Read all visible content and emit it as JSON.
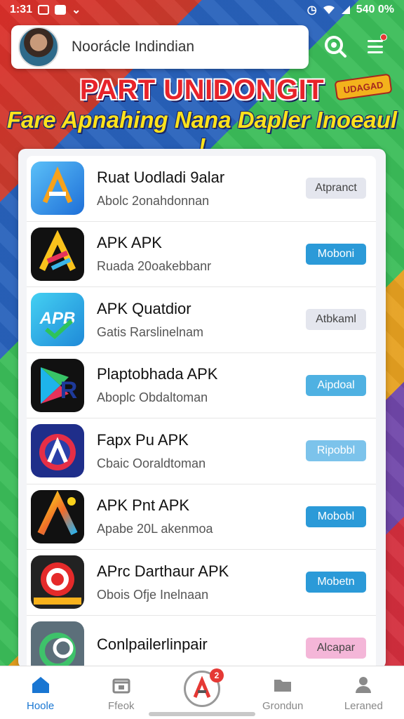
{
  "status_bar": {
    "time": "1:31",
    "battery": "540 0%"
  },
  "header": {
    "user_name": "Noorácle Indindian"
  },
  "banner": {
    "title": "PART UNIDONGIT",
    "tag": "UDAGAD",
    "subtitle": "Fare Apnahing Nana Dapler Inoeaul !"
  },
  "apps": [
    {
      "name": "Ruat Uodladi 9alar",
      "sub": "Abolc 2onahdonnan",
      "button": "Atpranct",
      "button_color": "#e4e6ee",
      "button_text_color": "#444",
      "icon": "android-arrow-icon",
      "icon_bg": "#3ba3e8"
    },
    {
      "name": "APK APK",
      "sub": "Ruada 20oakebbanr",
      "button": "Moboni",
      "button_color": "#2b9ad8",
      "button_text_color": "#fff",
      "icon": "rainbow-a-icon",
      "icon_bg": "#111111"
    },
    {
      "name": "APK Quatdior",
      "sub": "Gatis Rarslinelnam",
      "button": "Atbkaml",
      "button_color": "#e4e6ee",
      "button_text_color": "#444",
      "icon": "apb-check-icon",
      "icon_bg": "#2fb5e8"
    },
    {
      "name": "Plaptobhada APK",
      "sub": "Aboplc Obdaltoman",
      "button": "Aipdoal",
      "button_color": "#4fb1e2",
      "button_text_color": "#fff",
      "icon": "play-r-icon",
      "icon_bg": "#111111"
    },
    {
      "name": "Fapx Pu APK",
      "sub": "Cbaic Ooraldtoman",
      "button": "Ripobbl",
      "button_color": "#7cc3eb",
      "button_text_color": "#fff",
      "icon": "shield-a-icon",
      "icon_bg": "#1f2e8a"
    },
    {
      "name": "APK Pnt APK",
      "sub": "Apabe 20L akenmoa",
      "button": "Mobobl",
      "button_color": "#2b9ad8",
      "button_text_color": "#fff",
      "icon": "gradient-a-icon",
      "icon_bg": "#111111"
    },
    {
      "name": "APrc Darthaur APK",
      "sub": "Obois Ofje Inelnaan",
      "button": "Mobetn",
      "button_color": "#2b9ad8",
      "button_text_color": "#fff",
      "icon": "target-icon",
      "icon_bg": "#222222"
    },
    {
      "name": "Conlpailerlinpair",
      "sub": "",
      "button": "Alcapar",
      "button_color": "#f4b6d8",
      "button_text_color": "#444",
      "icon": "loop-icon",
      "icon_bg": "#5c6f7a"
    }
  ],
  "bottom_nav": [
    {
      "label": "Hoole",
      "icon": "home-icon",
      "active": true
    },
    {
      "label": "Ffeok",
      "icon": "store-icon",
      "active": false
    },
    {
      "label": "",
      "icon": "app-center-icon",
      "badge": "2",
      "active": false
    },
    {
      "label": "Grondun",
      "icon": "folder-icon",
      "active": false
    },
    {
      "label": "Leraned",
      "icon": "person-icon",
      "active": false
    }
  ]
}
